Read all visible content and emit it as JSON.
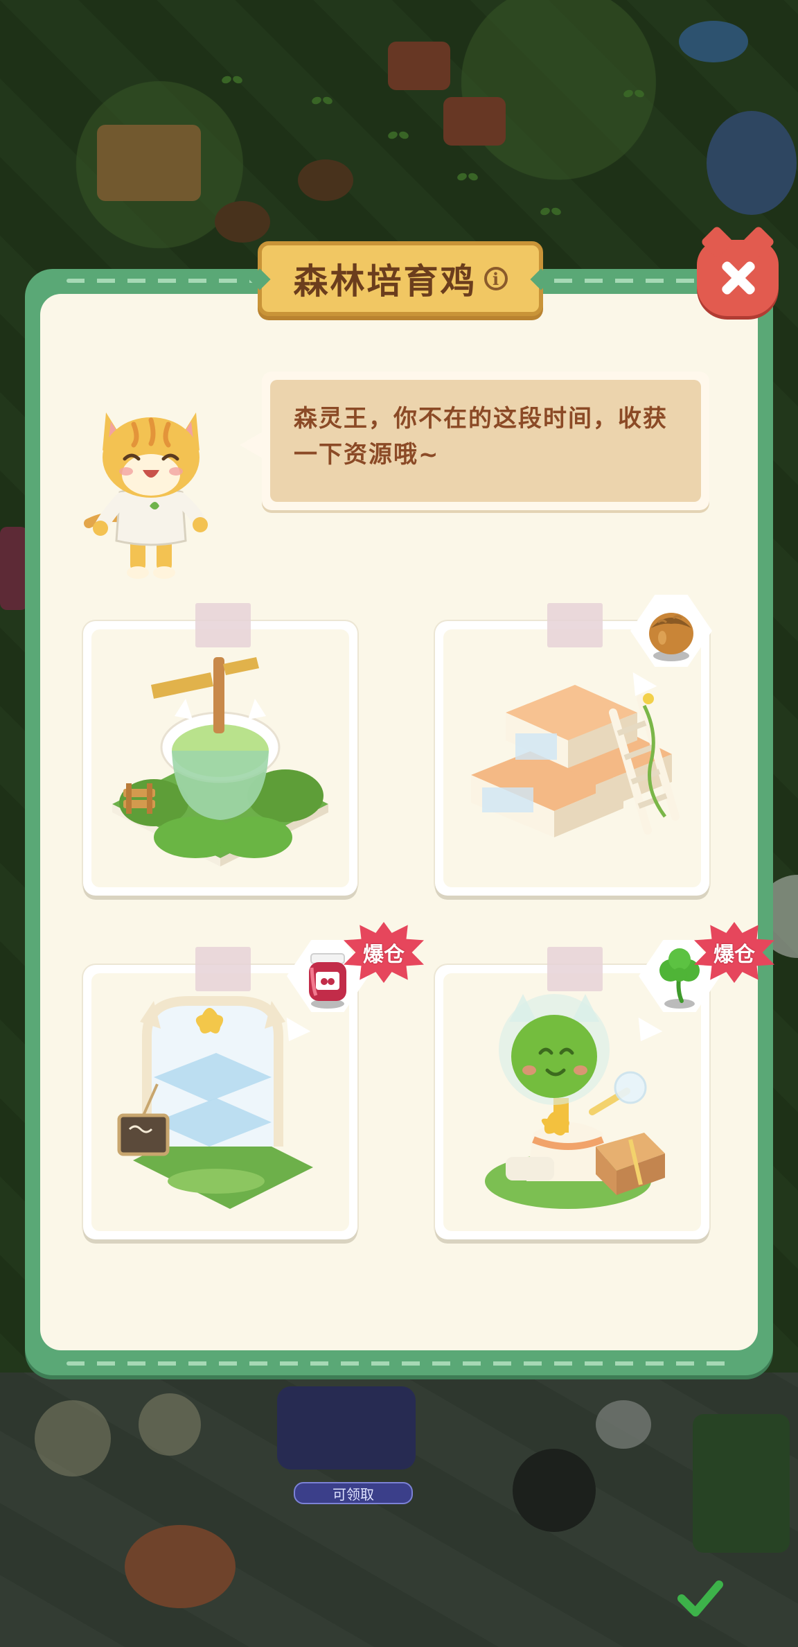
{
  "dialog": {
    "title": "森林培育鸡",
    "info_icon": "info-icon",
    "close_icon": "close-icon"
  },
  "mascot": {
    "speech": "森灵王，你不在的这段时间，收获一下资源哦~"
  },
  "buildings": [
    {
      "name": "pond-building",
      "resource": null,
      "badge": null
    },
    {
      "name": "storage-crates-building",
      "resource": "hazelnut-icon",
      "badge": null
    },
    {
      "name": "glass-shelf-building",
      "resource": "jam-jar-icon",
      "badge": "爆仓"
    },
    {
      "name": "clover-statue-building",
      "resource": "clover-icon",
      "badge": "爆仓"
    }
  ],
  "background": {
    "claim_label": "可领取"
  },
  "colors": {
    "frame_green": "#5aa876",
    "panel_cream": "#fbf7e8",
    "title_gold": "#f1c763",
    "close_red": "#e25b4f",
    "badge_red": "#e6465c",
    "text_brown": "#8b4a26"
  }
}
